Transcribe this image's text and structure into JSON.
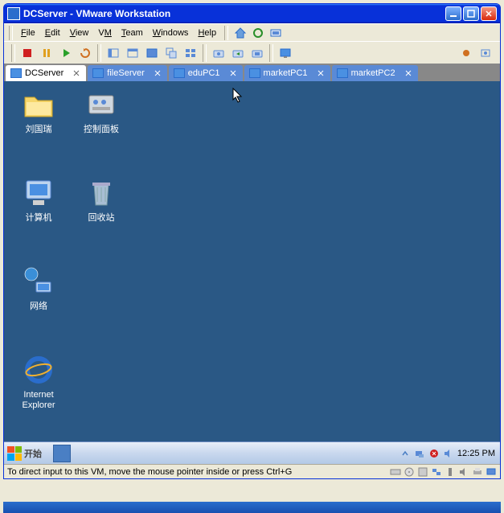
{
  "titlebar": {
    "title": "DCServer - VMware Workstation"
  },
  "menu": {
    "file": "File",
    "edit": "Edit",
    "view": "View",
    "vm": "VM",
    "team": "Team",
    "windows": "Windows",
    "help": "Help"
  },
  "tabs": [
    {
      "label": "DCServer",
      "active": true
    },
    {
      "label": "fileServer",
      "active": false
    },
    {
      "label": "eduPC1",
      "active": false
    },
    {
      "label": "marketPC1",
      "active": false
    },
    {
      "label": "marketPC2",
      "active": false
    }
  ],
  "desktop": {
    "icons_col1": [
      {
        "label": "刘国瑞",
        "kind": "folder"
      },
      {
        "label": "计算机",
        "kind": "computer"
      },
      {
        "label": "网络",
        "kind": "network"
      },
      {
        "label": "Internet\nExplorer",
        "kind": "ie"
      }
    ],
    "icons_col2": [
      {
        "label": "控制面板",
        "kind": "control-panel"
      },
      {
        "label": "回收站",
        "kind": "recycle-bin"
      }
    ]
  },
  "vm_taskbar": {
    "start": "开始",
    "clock": "12:25 PM"
  },
  "statusbar": {
    "text": "To direct input to this VM, move the mouse pointer inside or press Ctrl+G"
  }
}
